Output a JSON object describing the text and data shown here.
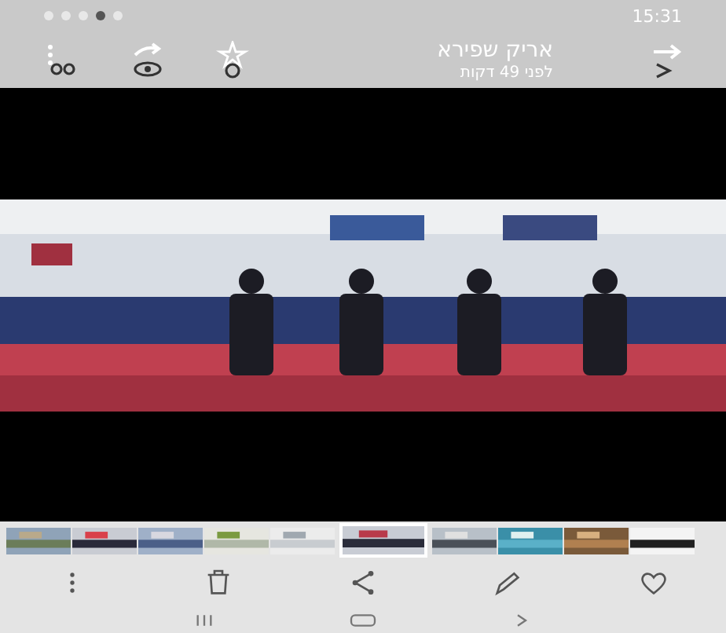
{
  "status_bar": {
    "time": "15:31"
  },
  "header": {
    "title": "אריק שפירא",
    "subtitle": "לפני 49 דקות"
  },
  "thumbnails": [
    {
      "selected": false
    },
    {
      "selected": false
    },
    {
      "selected": false
    },
    {
      "selected": false
    },
    {
      "selected": false
    },
    {
      "selected": true
    },
    {
      "selected": false
    },
    {
      "selected": false
    },
    {
      "selected": false
    },
    {
      "selected": false
    }
  ]
}
